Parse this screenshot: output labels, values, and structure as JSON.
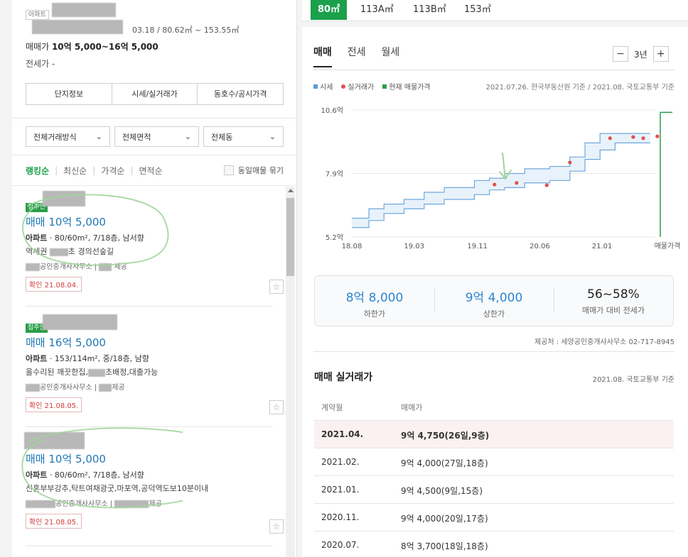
{
  "complex": {
    "type_tag": "아파트",
    "meta": "03.18 / 80.62㎡ ~ 153.55㎡",
    "sale_label": "매매가 ",
    "sale_price": "10억 5,000~16억 5,000",
    "jeonse": "전세가 -",
    "tabs": [
      "단지정보",
      "시세/실거래가",
      "동호수/공시가격"
    ]
  },
  "filters": [
    "전체거래방식",
    "전체면적",
    "전체동"
  ],
  "sort": {
    "options": [
      "랭킹순",
      "최신순",
      "가격순",
      "면적순"
    ],
    "group_label": "동일매물 묶기"
  },
  "listings": [
    {
      "badge": "집주인",
      "title": "매매 10억 5,000",
      "desc_type": "아파트",
      "desc": " · 80/60m², 7/18층, 남서향",
      "sub_a": "역세권 ",
      "sub_b": "초 경의선숲길",
      "agent": "공인중개사사무소",
      "provider": "제공",
      "confirm": "확인 21.08.04."
    },
    {
      "badge": "집주인",
      "title": "매매 16억 5,000",
      "desc_type": "아파트",
      "desc": " · 153/114m², 중/18층, 남향",
      "sub_a": "올수리된 깨끗한집,",
      "sub_b": "초배정,대출가능",
      "agent": "공인중개사사무소",
      "provider": "제공",
      "confirm": "확인 21.08.05."
    },
    {
      "badge": "",
      "title": "매매 10억 5,000",
      "desc_type": "아파트",
      "desc": " · 80/60m², 7/18층, 남서향",
      "sub_a": "신혼부부강추,탁트여채광굿,마포역,공덕역도보10분이내",
      "sub_b": "",
      "agent": "공인중개사사무소",
      "provider": "제공",
      "confirm": "확인 21.08.05."
    }
  ],
  "area_tabs": [
    "80㎡",
    "113A㎡",
    "113B㎡",
    "153㎡"
  ],
  "right": {
    "tabs": [
      "매매",
      "전세",
      "월세"
    ],
    "period": "3년",
    "minus": "−",
    "plus": "+",
    "legend": [
      "시세",
      "실거래가",
      "현재 매물가격"
    ],
    "source": "2021.07.26. 한국부동산원 기준 / 2021.08. 국토교통부 기준",
    "stats": [
      {
        "value": "8억 8,000",
        "label": "하한가"
      },
      {
        "value": "9억 4,000",
        "label": "상한가"
      },
      {
        "value": "56~58%",
        "label": "매매가 대비 전세가"
      }
    ],
    "provider": "제공처 : 세양공인중개사사무소 02-717-8945",
    "deal_title": "매매 실거래가",
    "deal_source": "2021.08. 국토교통부 기준",
    "deal_headers": [
      "계약월",
      "매매가"
    ],
    "deals": [
      {
        "month": "2021.04.",
        "price": "9억 4,750(26일,9층)"
      },
      {
        "month": "2021.02.",
        "price": "9억 4,000(27일,18층)"
      },
      {
        "month": "2021.01.",
        "price": "9억 4,500(9일,15층)"
      },
      {
        "month": "2020.11.",
        "price": "9억 4,000(20일,17층)"
      },
      {
        "month": "2020.07.",
        "price": "8억 3,700(18일,18층)"
      }
    ]
  },
  "colors": {
    "accent": "#1ba04c",
    "market_band": "#5b9bd5",
    "deal_dot": "#e05050",
    "listing_line": "#2a9d49",
    "price_blue": "#2e86d3"
  },
  "chart_data": {
    "type": "line",
    "x_ticks": [
      "18.08",
      "19.03",
      "19.11",
      "20.06",
      "21.01",
      "매물가격"
    ],
    "y_ticks": [
      "5.2억",
      "7.9억",
      "10.6억"
    ],
    "ylim": [
      5.2,
      10.6
    ],
    "xlim": [
      2018.58,
      2021.6
    ],
    "series": [
      {
        "name": "시세",
        "upper": [
          [
            2018.58,
            6.0
          ],
          [
            2018.75,
            6.4
          ],
          [
            2018.9,
            6.6
          ],
          [
            2019.1,
            6.8
          ],
          [
            2019.3,
            7.1
          ],
          [
            2019.5,
            7.3
          ],
          [
            2019.8,
            7.6
          ],
          [
            2019.95,
            7.7
          ],
          [
            2020.1,
            7.9
          ],
          [
            2020.3,
            8.1
          ],
          [
            2020.55,
            8.2
          ],
          [
            2020.75,
            8.6
          ],
          [
            2020.9,
            9.2
          ],
          [
            2021.05,
            9.6
          ],
          [
            2021.2,
            9.6
          ],
          [
            2021.55,
            9.6
          ]
        ],
        "lower": [
          [
            2018.58,
            5.6
          ],
          [
            2018.75,
            5.9
          ],
          [
            2018.9,
            6.2
          ],
          [
            2019.1,
            6.4
          ],
          [
            2019.3,
            6.6
          ],
          [
            2019.5,
            6.8
          ],
          [
            2019.8,
            7.0
          ],
          [
            2019.95,
            7.2
          ],
          [
            2020.1,
            7.3
          ],
          [
            2020.3,
            7.5
          ],
          [
            2020.55,
            7.6
          ],
          [
            2020.75,
            8.0
          ],
          [
            2020.9,
            8.5
          ],
          [
            2021.05,
            8.9
          ],
          [
            2021.2,
            9.2
          ],
          [
            2021.55,
            9.2
          ]
        ]
      },
      {
        "name": "실거래가",
        "points": [
          [
            2020.0,
            7.43
          ],
          [
            2020.22,
            7.5
          ],
          [
            2020.52,
            7.4
          ],
          [
            2020.75,
            8.37
          ],
          [
            2021.15,
            9.4
          ],
          [
            2021.38,
            9.45
          ],
          [
            2021.48,
            9.4
          ],
          [
            2021.62,
            9.48
          ]
        ]
      },
      {
        "name": "현재 매물가격",
        "range": [
          10.5,
          5.2
        ]
      }
    ]
  }
}
